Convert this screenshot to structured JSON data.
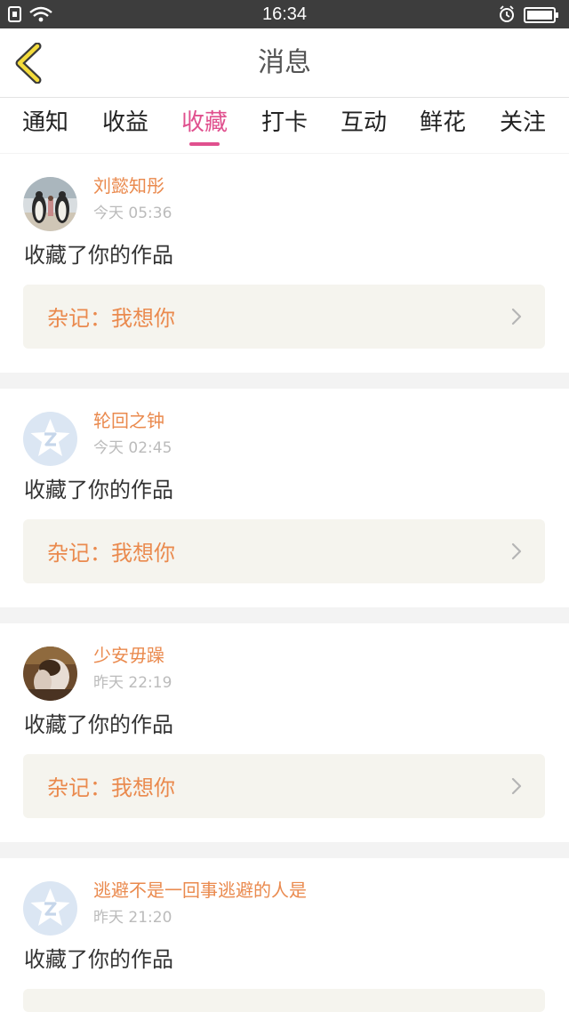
{
  "status_bar": {
    "time": "16:34"
  },
  "header": {
    "title": "消息"
  },
  "tabs": [
    {
      "label": "通知"
    },
    {
      "label": "收益"
    },
    {
      "label": "收藏"
    },
    {
      "label": "打卡"
    },
    {
      "label": "互动"
    },
    {
      "label": "鲜花"
    },
    {
      "label": "关注"
    }
  ],
  "active_tab": "收藏",
  "colors": {
    "accent": "#e0508e",
    "name": "#ea8a4e",
    "card_bg": "#f5f4ee"
  },
  "messages": [
    {
      "username": "刘懿知彤",
      "time": "今天 05:36",
      "action": "收藏了你的作品",
      "work": "杂记：我想你",
      "avatar": "penguins-photo"
    },
    {
      "username": "轮回之钟",
      "time": "今天 02:45",
      "action": "收藏了你的作品",
      "work": "杂记：我想你",
      "avatar": "default-star-avatar"
    },
    {
      "username": "少安毋躁",
      "time": "昨天 22:19",
      "action": "收藏了你的作品",
      "work": "杂记：我想你",
      "avatar": "portrait-photo"
    },
    {
      "username": "逃避不是一回事逃避的人是",
      "time": "昨天 21:20",
      "action": "收藏了你的作品",
      "work": "",
      "avatar": "default-star-avatar"
    }
  ]
}
